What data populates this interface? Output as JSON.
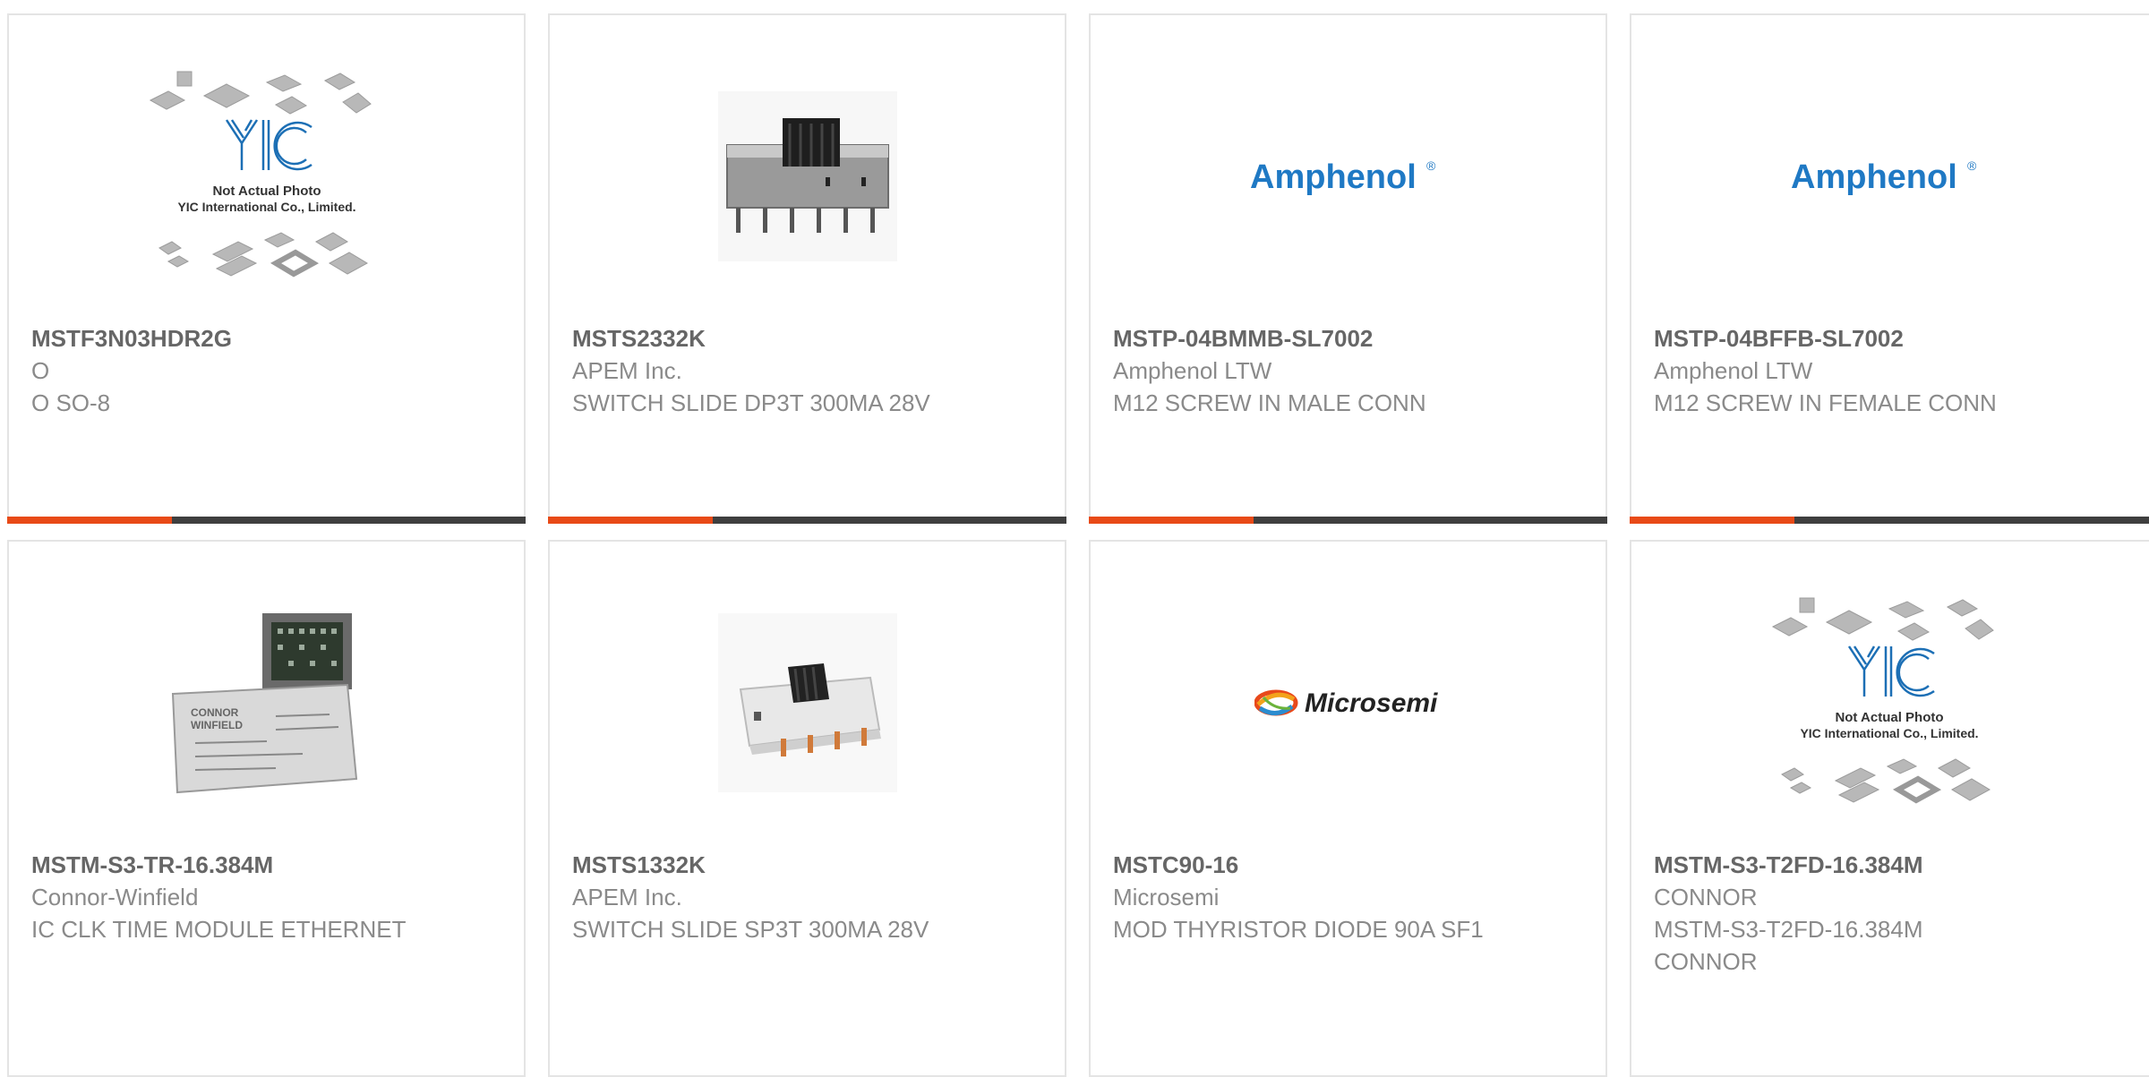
{
  "products": [
    {
      "part": "MSTF3N03HDR2G",
      "manufacturer": "O",
      "description": "O SO-8",
      "image": "not-actual-photo",
      "placeholder_line1": "Not Actual Photo",
      "placeholder_line2": "YIC International Co., Limited.",
      "logo_text": "YIC"
    },
    {
      "part": "MSTS2332K",
      "manufacturer": "APEM Inc.",
      "description": "SWITCH SLIDE DP3T 300MA 28V",
      "image": "slide-switch"
    },
    {
      "part": "MSTP-04BMMB-SL7002",
      "manufacturer": "Amphenol LTW",
      "description": "M12 SCREW IN MALE CONN",
      "image": "amphenol-logo",
      "logo_text": "Amphenol",
      "logo_mark": "®"
    },
    {
      "part": "MSTP-04BFFB-SL7002",
      "manufacturer": "Amphenol LTW",
      "description": "M12 SCREW IN FEMALE CONN",
      "image": "amphenol-logo",
      "logo_text": "Amphenol",
      "logo_mark": "®"
    },
    {
      "part": "MSTM-S3-TR-16.384M",
      "manufacturer": "Connor-Winfield",
      "description": "IC CLK TIME MODULE ETHERNET",
      "image": "clock-module",
      "module_label1": "CONNOR",
      "module_label2": "WINFIELD"
    },
    {
      "part": "MSTS1332K",
      "manufacturer": "APEM Inc.",
      "description": "SWITCH SLIDE SP3T 300MA 28V",
      "image": "slide-switch-small"
    },
    {
      "part": "MSTC90-16",
      "manufacturer": "Microsemi",
      "description": "MOD THYRISTOR DIODE 90A SF1",
      "image": "microsemi-logo",
      "logo_text": "Microsemi"
    },
    {
      "part": "MSTM-S3-T2FD-16.384M",
      "manufacturer": "CONNOR",
      "description": "MSTM-S3-T2FD-16.384M CONNOR",
      "image": "not-actual-photo",
      "placeholder_line1": "Not Actual Photo",
      "placeholder_line2": "YIC International Co., Limited.",
      "logo_text": "YIC"
    }
  ],
  "colors": {
    "accent": "#e84a17",
    "bar": "#3f3f3f",
    "amphenol_blue": "#1f79c4",
    "yic_blue": "#1c6fb5"
  }
}
